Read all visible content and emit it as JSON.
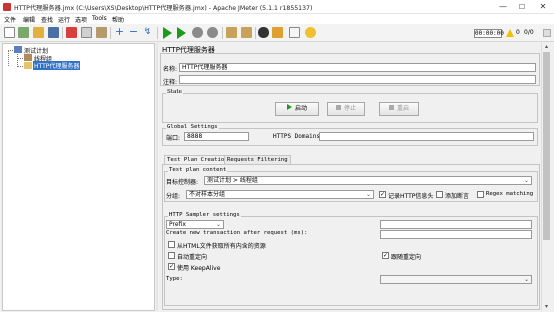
{
  "window": {
    "title": "HTTP代理服务器.jmx (C:\\Users\\XS\\Desktop\\HTTP代理服务器.jmx) - Apache JMeter (5.1.1 r1855137)",
    "controls": {
      "minimize": "—",
      "maximize": "☐",
      "close": "✕"
    }
  },
  "menu": [
    "文件",
    "编辑",
    "查找",
    "运行",
    "选项",
    "Tools",
    "帮助"
  ],
  "toolbar": {
    "timer": "00:00:00",
    "errors": "0",
    "running": "0/0",
    "icons": [
      "new-icon",
      "templates-icon",
      "open-icon",
      "save-icon",
      "cut-icon",
      "copy-icon",
      "paste-icon",
      "expand-icon",
      "collapse-icon",
      "toggle-icon",
      "start-icon",
      "start-no-pause-icon",
      "stop-icon",
      "shutdown-icon",
      "clear-icon",
      "clear-all-icon",
      "search-icon",
      "reset-search-icon",
      "function-helper-icon",
      "help-icon"
    ]
  },
  "tree": {
    "root": "测试计划",
    "children": [
      "线程组",
      "HTTP代理服务器"
    ],
    "selected": "HTTP代理服务器"
  },
  "panel": {
    "heading": "HTTP代理服务器",
    "name_label": "名称:",
    "name_value": "HTTP代理服务器",
    "comment_label": "注释:",
    "comment_value": "",
    "state": {
      "title": "State",
      "start": "启动",
      "stop": "停止",
      "restart": "重启"
    },
    "global": {
      "title": "Global Settings",
      "port_label": "端口:",
      "port_value": "8888",
      "https_label": "HTTPS Domains:",
      "https_value": ""
    },
    "tabs": [
      "Test Plan Creation",
      "Requests Filtering"
    ],
    "test_plan_content": {
      "title": "Test plan content",
      "target_label": "目标控制器:",
      "target_value": "测试计划 > 线程组",
      "grouping_label": "分组:",
      "grouping_value": "不对样本分组",
      "record_headers": "记录HTTP信息头",
      "add_assertion": "添加断言",
      "regex_matching": "Regex matching"
    },
    "sampler": {
      "title": "HTTP Sampler settings",
      "prefix_value": "Prefix",
      "prefix_text": "",
      "transaction_label": "Create new transaction after request (ms):",
      "transaction_value": "",
      "retrieve_resources": "从HTML文件获取所有内含的资源",
      "auto_redirect": "自动重定向",
      "follow_redirects": "跟随重定向",
      "keepalive": "使用 KeepAlive",
      "type_label": "Type:",
      "type_value": ""
    },
    "checks": {
      "record_headers": true,
      "add_assertion": false,
      "regex_matching": false,
      "retrieve_resources": false,
      "auto_redirect": false,
      "follow_redirects": true,
      "keepalive": true
    }
  },
  "colors": {
    "start_icon": "#1a9b1a",
    "selected_tree_bg": "#3073c6",
    "warning": "#f2c200"
  }
}
